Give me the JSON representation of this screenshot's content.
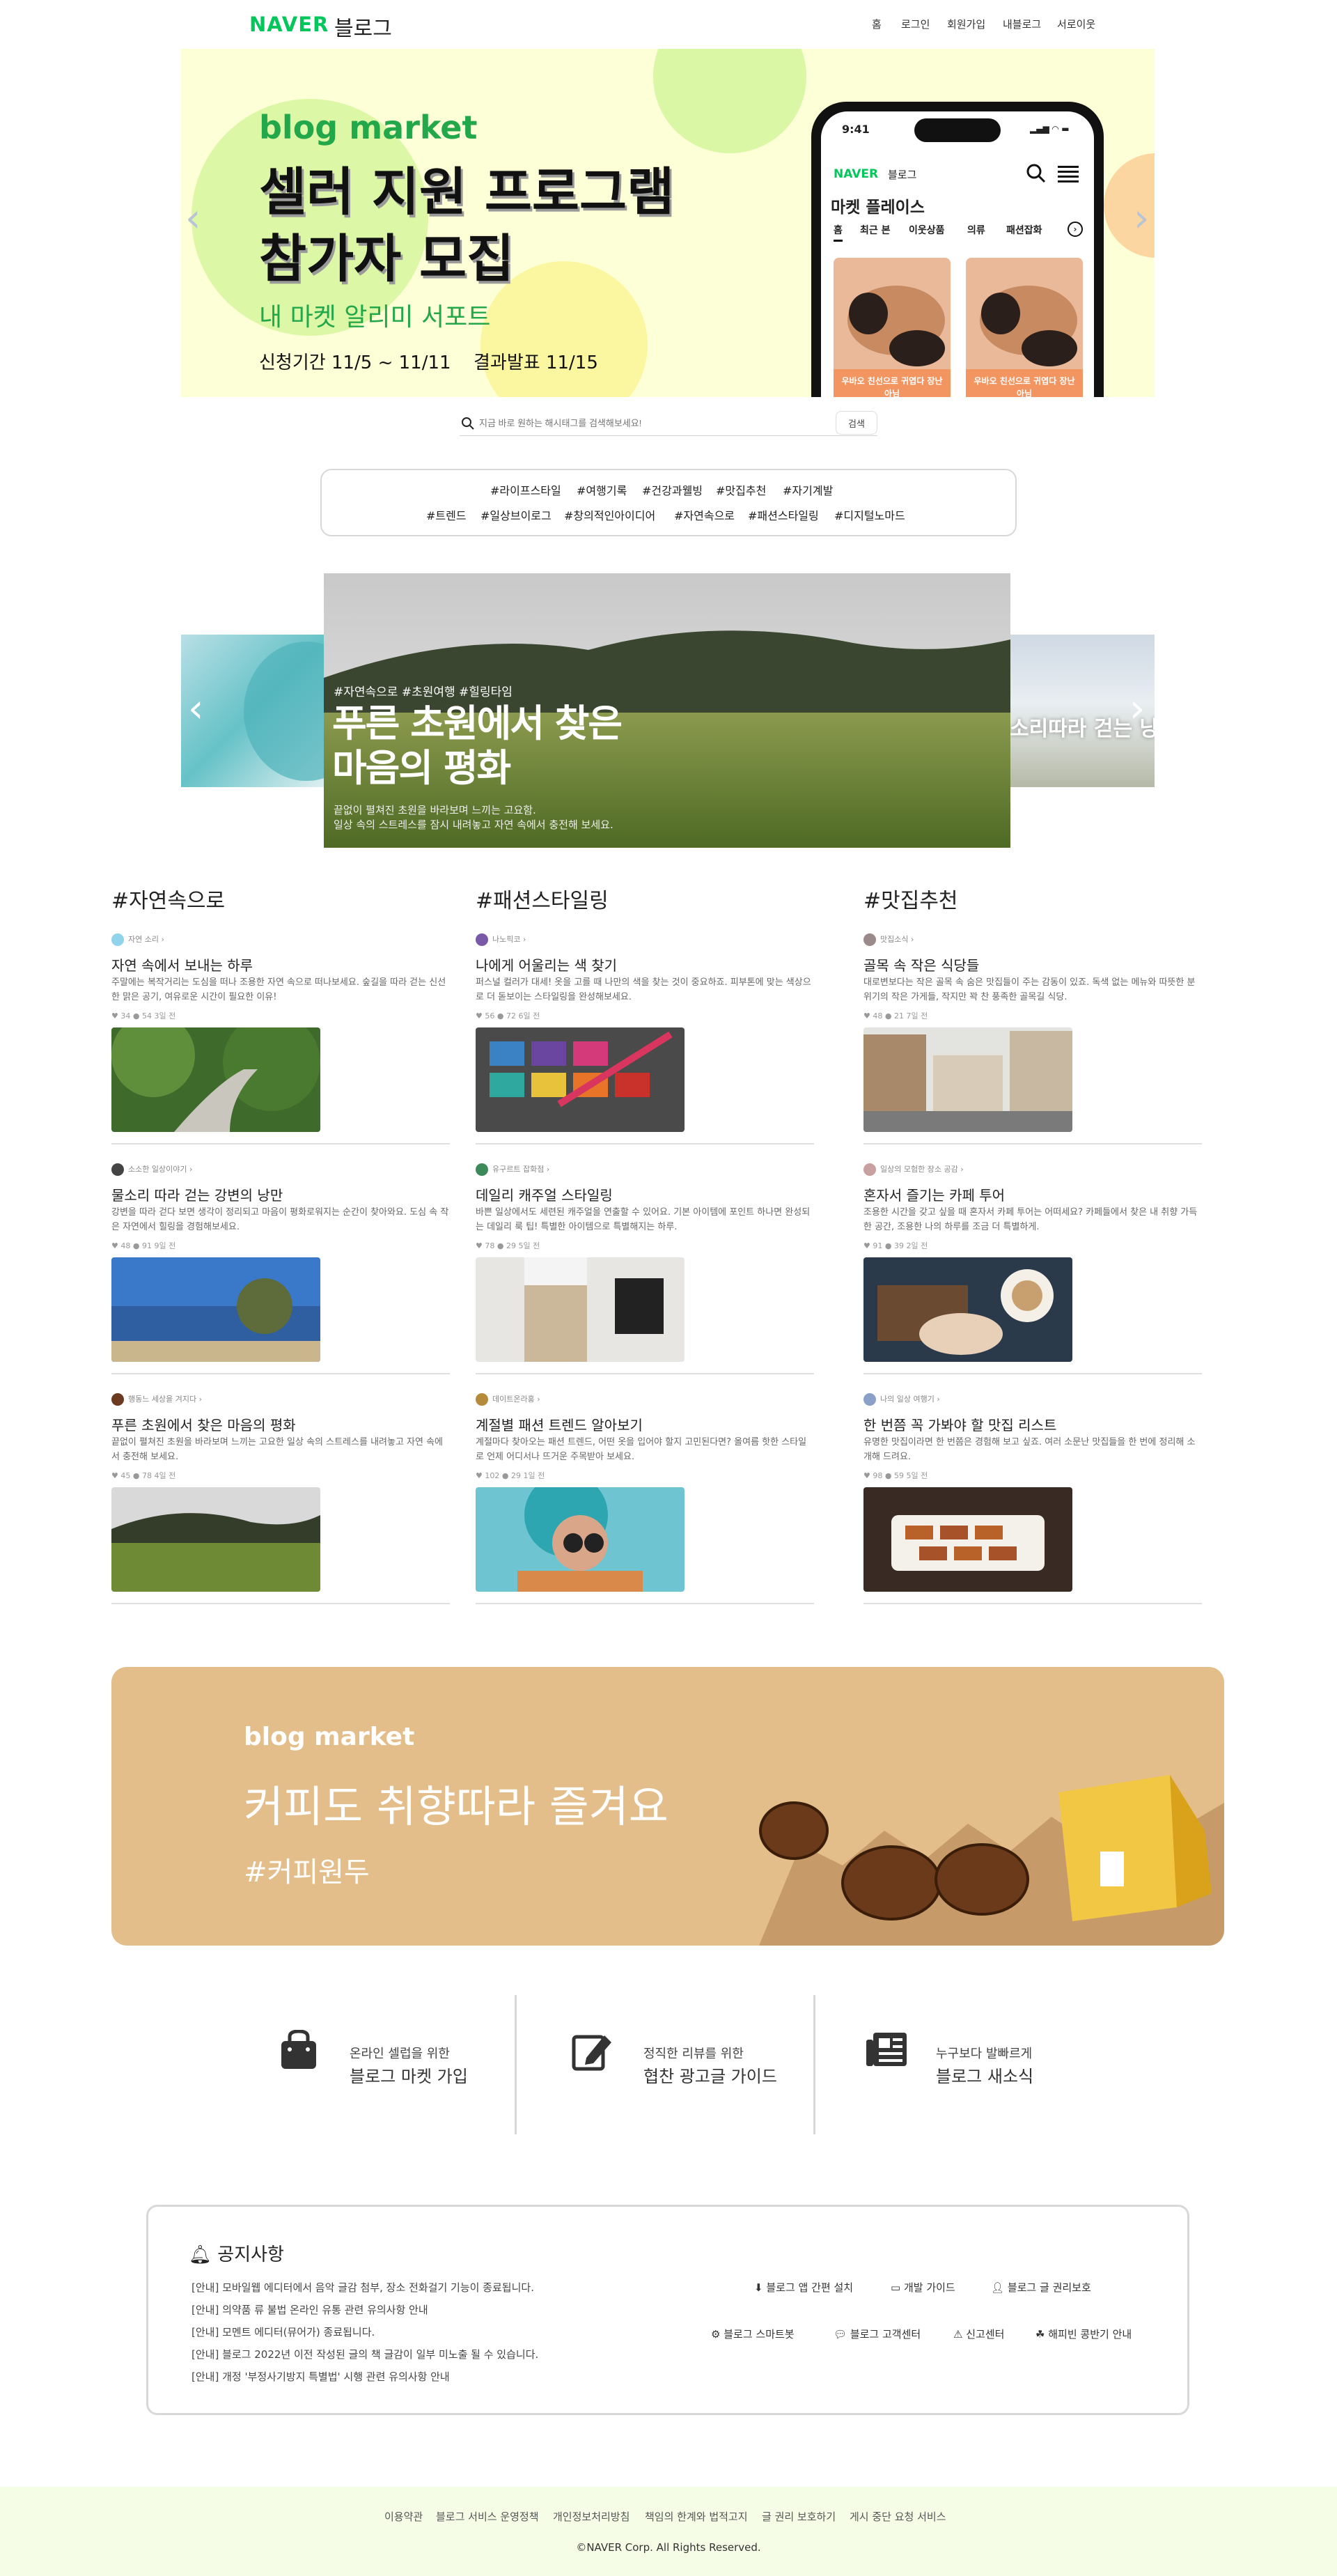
{
  "header": {
    "logo": "NAVER",
    "logo_suffix": "블로그",
    "nav": [
      "홈",
      "로그인",
      "회원가입",
      "내블로그",
      "서로이웃"
    ]
  },
  "hero": {
    "tag": "blog market",
    "title_line1": "셀러 지원 프로그램",
    "title_line2": "참가자 모집",
    "subtitle": "내 마켓 알리미 서포트",
    "date_apply": "신청기간 11/5 ~ 11/11",
    "date_result": "결과발표 11/15",
    "phone": {
      "time": "9:41",
      "logo": "NAVER",
      "logo_suffix": "블로그",
      "title": "마켓 플레이스",
      "tabs": [
        "홈",
        "최근 본",
        "이웃상품",
        "의류",
        "패션잡화"
      ],
      "card_label": "우바오 친선으로 귀엽다 장난아님"
    }
  },
  "search": {
    "placeholder": "지금 바로 원하는 해시태그를 검색해보세요!",
    "button": "검색"
  },
  "hashtags": {
    "row1": [
      "#라이프스타일",
      "#여행기록",
      "#건강과웰빙",
      "#맛집추천",
      "#자기계발"
    ],
    "row2": [
      "#트렌드",
      "#일상브이로그",
      "#창의적인아이디어",
      "#자연속으로",
      "#패션스타일링",
      "#디지털노마드"
    ]
  },
  "carousel": {
    "tags": "#자연속으로 #초원여행 #힐링타임",
    "title_line1": "푸른 초원에서 찾은",
    "title_line2": "마음의 평화",
    "desc_line1": "끝없이 펼쳐진 초원을 바라보며 느끼는 고요함.",
    "desc_line2": "일상 속의 스트레스를 잠시 내려놓고 자연 속에서 충전해 보세요.",
    "next_peek": "소리따라 걷는 낭"
  },
  "columns": [
    {
      "title": "#자연속으로",
      "posts": [
        {
          "author": "자연 소리",
          "title": "자연 속에서 보내는 하루",
          "desc": "주말에는 복작거리는 도심을 떠나 조용한 자연 속으로 떠나보세요. 숲길을 따라 걷는 신선한 맑은 공기, 여유로운 시간이 필요한 이유!",
          "likes": "34",
          "comments": "54",
          "time": "3일 전"
        },
        {
          "author": "소소한 일상이야기",
          "title": "물소리 따라 걷는 강변의 낭만",
          "desc": "강변을 따라 걷다 보면 생각이 정리되고 마음이 평화로워지는 순간이 찾아와요. 도심 속 작은 자연에서 힐링을 경험해보세요.",
          "likes": "48",
          "comments": "91",
          "time": "9일 전"
        },
        {
          "author": "행동느 세상을 겨지다",
          "title": "푸른 초원에서 찾은 마음의 평화",
          "desc": "끝없이 펼쳐진 초원을 바라보며 느끼는 고요한 일상 속의 스트레스를 내려놓고 자연 속에서 충전해 보세요.",
          "likes": "45",
          "comments": "78",
          "time": "4일 전"
        }
      ]
    },
    {
      "title": "#패션스타일링",
      "posts": [
        {
          "author": "나노픽코",
          "title": "나에게 어울리는 색 찾기",
          "desc": "퍼스널 컬러가 대세! 옷을 고를 때 나만의 색을 찾는 것이 중요하죠. 피부톤에 맞는 색상으로 더 돋보이는 스타일링을 완성해보세요.",
          "likes": "56",
          "comments": "72",
          "time": "6일 전"
        },
        {
          "author": "유구르트 잡화점",
          "title": "데일리 캐주얼 스타일링",
          "desc": "바쁜 일상에서도 세련된 캐주얼을 연출할 수 있어요. 기본 아이템에 포인트 하나면 완성되는 데일리 룩 팁! 특별한 아이템으로 특별해지는 하루.",
          "likes": "78",
          "comments": "29",
          "time": "5일 전"
        },
        {
          "author": "데이트온라홍",
          "title": "계절별 패션 트렌드 알아보기",
          "desc": "계절마다 찾아오는 패션 트렌드, 어떤 옷을 입어야 할지 고민된다면? 올여름 핫한 스타일로 언제 어디서나 뜨거운 주목받아 보세요.",
          "likes": "102",
          "comments": "29",
          "time": "1일 전"
        }
      ]
    },
    {
      "title": "#맛집추천",
      "posts": [
        {
          "author": "맛집소식",
          "title": "골목 속 작은 식당들",
          "desc": "대로변보다는 작은 골목 속 숨은 맛집들이 주는 감동이 있죠. 독색 없는 메뉴와 따뜻한 분위기의 작은 가게들, 작지만 꽉 찬 풍족한 골목길 식당.",
          "likes": "48",
          "comments": "21",
          "time": "7일 전"
        },
        {
          "author": "일상의 모험한 장소 공감",
          "title": "혼자서 즐기는 카페 투어",
          "desc": "조용한 시간을 갖고 싶을 때 혼자서 카페 투어는 어떠세요? 카페들에서 찾은 내 취향 가득한 공간, 조용한 나의 하루를 조금 더 특별하게.",
          "likes": "91",
          "comments": "39",
          "time": "2일 전"
        },
        {
          "author": "나의 일상 여행기",
          "title": "한 번쯤 꼭 가봐야 할 맛집 리스트",
          "desc": "유명한 맛집이라면 한 번쯤은 경험해 보고 싶죠. 여러 소문난 맛집들을 한 번에 정리해 소개해 드려요.",
          "likes": "98",
          "comments": "59",
          "time": "5일 전"
        }
      ]
    }
  ],
  "promo": {
    "tag": "blog market",
    "title": "커피도 취향따라 즐겨요",
    "hashtag": "#커피원두"
  },
  "services": [
    {
      "icon": "shopping-bag-icon",
      "line1": "온라인 셀럽을 위한",
      "line2": "블로그 마켓 가입"
    },
    {
      "icon": "edit-icon",
      "line1": "정직한 리뷰를 위한",
      "line2": "협찬 광고글 가이드"
    },
    {
      "icon": "newspaper-icon",
      "line1": "누구보다 발빠르게",
      "line2": "블로그 새소식"
    }
  ],
  "notice": {
    "title": "공지사항",
    "items": [
      "[안내] 모바일웹 에디터에서 음악 글감 첨부, 장소 전화걸기 기능이 종료됩니다.",
      "[안내] 의약품 류 불법 온라인 유통 관련 유의사항 안내",
      "[안내] 모멘트 에디터(뮤어가) 종료됩니다.",
      "[안내] 블로그 2022년 이전 작성된 글의 책 글감이 일부 미노출 될 수 있습니다.",
      "[안내] 개정 '부정사기방지 특별법' 시행 관련 유의사항 안내"
    ],
    "links_row1": [
      "블로그 앱 간편 설치",
      "개발 가이드",
      "블로그 글 권리보호"
    ],
    "links_row2": [
      "블로그 스마트봇",
      "블로그 고객센터",
      "신고센터",
      "해피빈 콩반기 안내"
    ]
  },
  "footer": {
    "links": [
      "이용약관",
      "블로그 서비스 운영정책",
      "개인정보처리방침",
      "책임의 한계와 법적고지",
      "글 권리 보호하기",
      "게시 중단 요청 서비스"
    ],
    "copyright": "©NAVER Corp. All Rights Reserved."
  },
  "colors": {
    "brand_green": "#03c75a",
    "hero_bg": "#fdffd6",
    "hero_green": "#22a84a",
    "promo_bg": "#e3be8a",
    "footer_bg": "#f5fde6"
  }
}
